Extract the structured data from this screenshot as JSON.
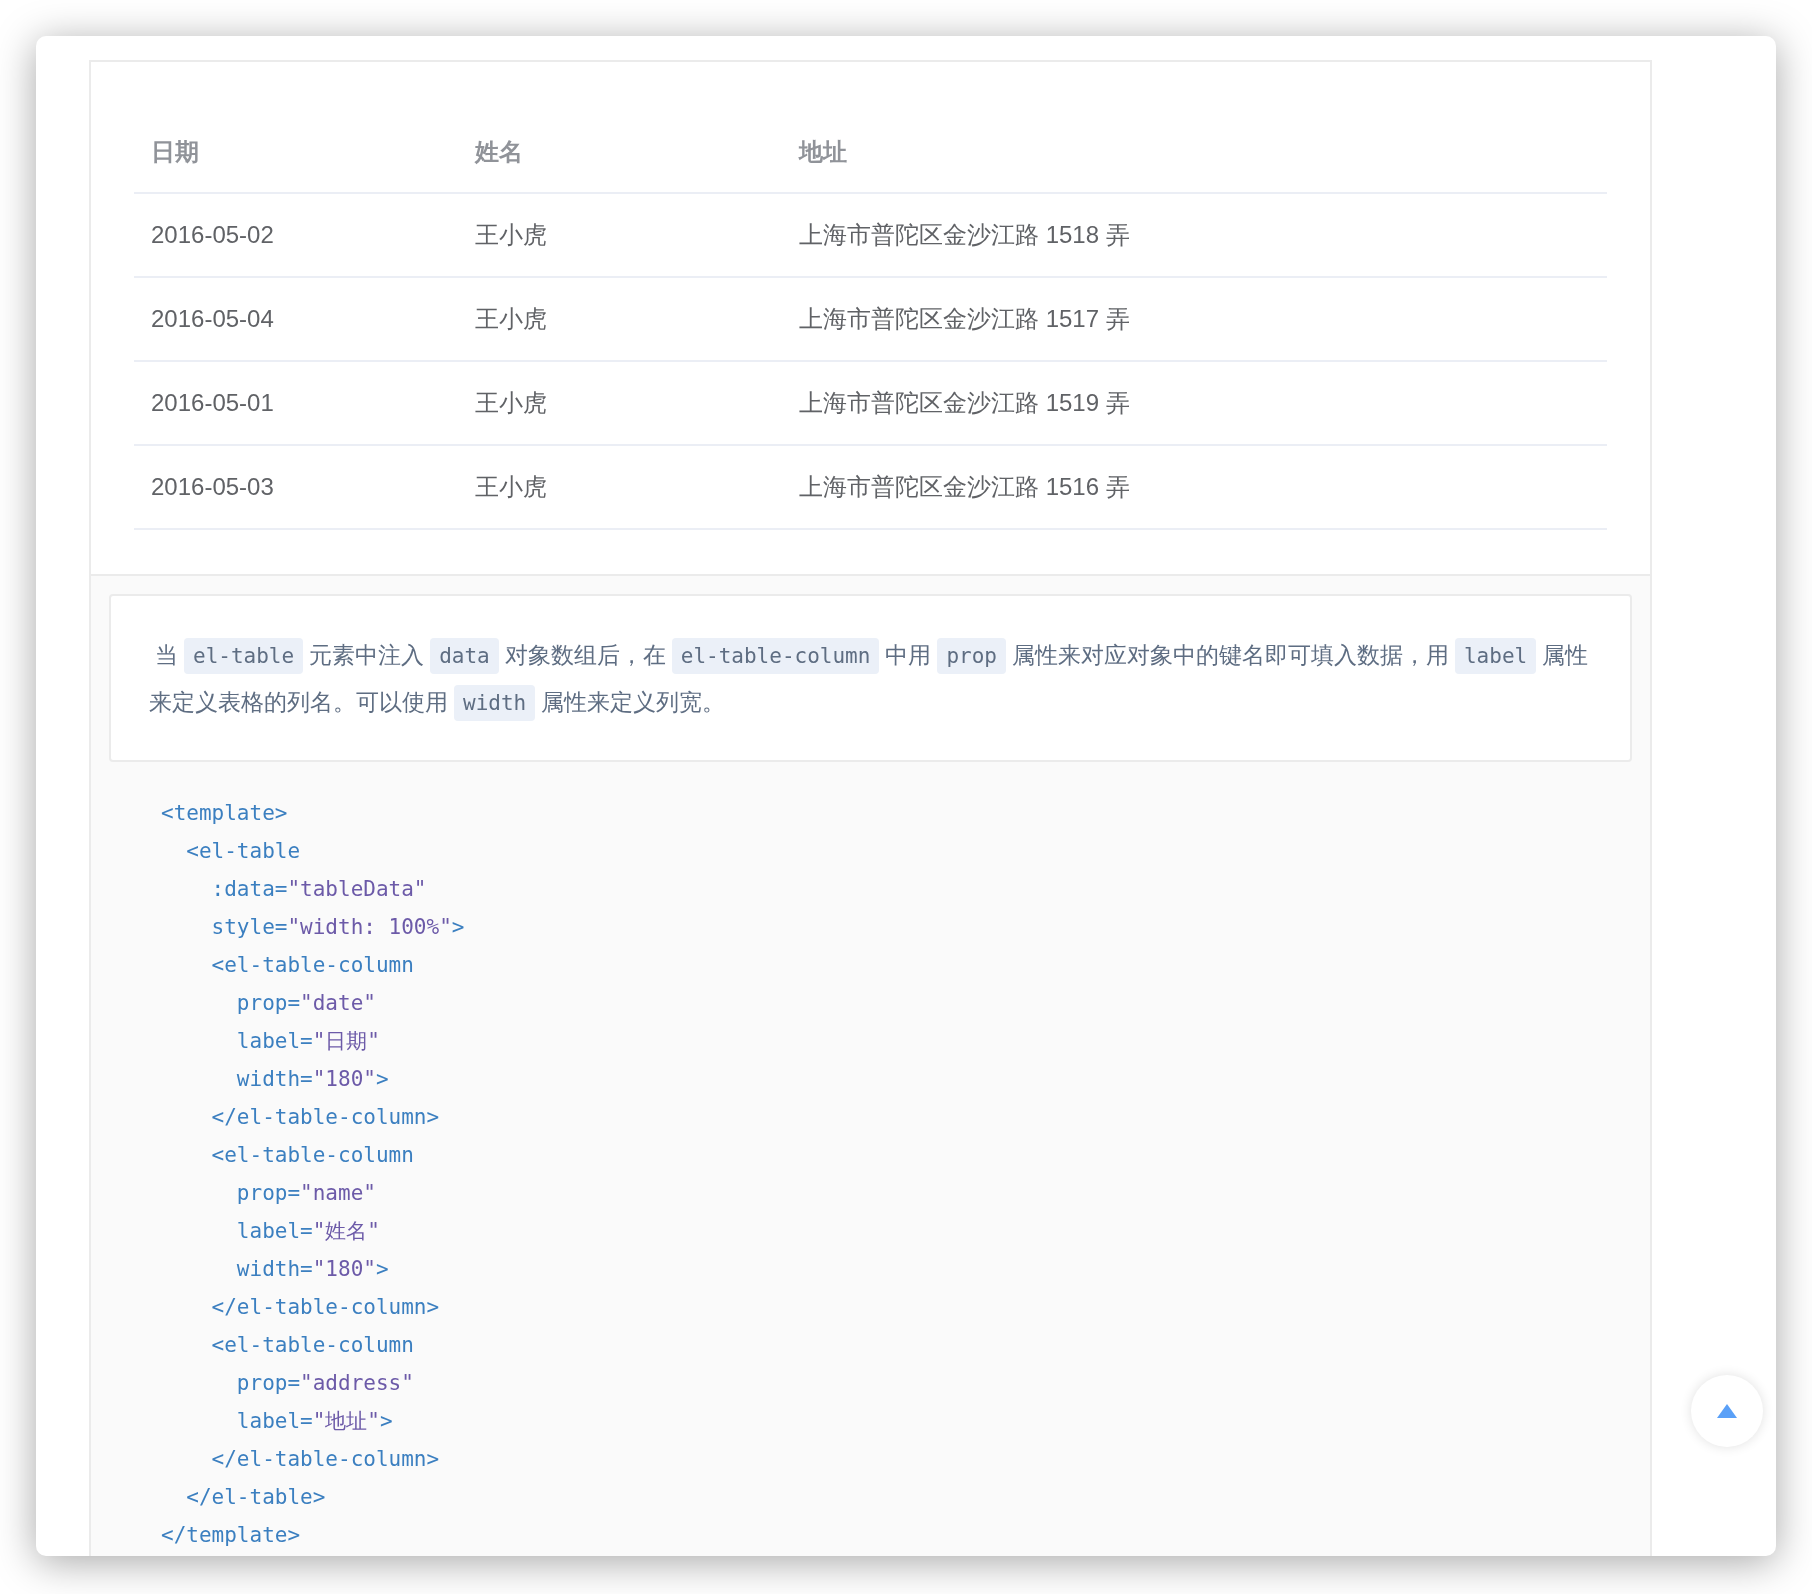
{
  "table": {
    "columns": [
      "日期",
      "姓名",
      "地址"
    ],
    "rows": [
      [
        "2016-05-02",
        "王小虎",
        "上海市普陀区金沙江路 1518 弄"
      ],
      [
        "2016-05-04",
        "王小虎",
        "上海市普陀区金沙江路 1517 弄"
      ],
      [
        "2016-05-01",
        "王小虎",
        "上海市普陀区金沙江路 1519 弄"
      ],
      [
        "2016-05-03",
        "王小虎",
        "上海市普陀区金沙江路 1516 弄"
      ]
    ]
  },
  "description": [
    {
      "kind": "text",
      "text": "当"
    },
    {
      "kind": "code",
      "text": "el-table"
    },
    {
      "kind": "text",
      "text": "元素中注入"
    },
    {
      "kind": "code",
      "text": "data"
    },
    {
      "kind": "text",
      "text": "对象数组后，在"
    },
    {
      "kind": "code",
      "text": "el-table-column"
    },
    {
      "kind": "text",
      "text": "中用"
    },
    {
      "kind": "code",
      "text": "prop"
    },
    {
      "kind": "text",
      "text": "属性来对应对象中的键名即可填入数据，用"
    },
    {
      "kind": "code",
      "text": "label"
    },
    {
      "kind": "text",
      "text": "属性来定义表格的列名。可以使用"
    },
    {
      "kind": "code",
      "text": "width"
    },
    {
      "kind": "text",
      "text": "属性来定义列宽。"
    }
  ],
  "code_lines": [
    [
      {
        "kind": "tag",
        "text": "<template>"
      }
    ],
    [
      {
        "kind": "tag",
        "text": "  <el-table"
      }
    ],
    [
      {
        "kind": "attr",
        "text": "    :data="
      },
      {
        "kind": "string",
        "text": "\"tableData\""
      }
    ],
    [
      {
        "kind": "attr",
        "text": "    style="
      },
      {
        "kind": "string",
        "text": "\"width: 100%\""
      },
      {
        "kind": "tag",
        "text": ">"
      }
    ],
    [
      {
        "kind": "tag",
        "text": "    <el-table-column"
      }
    ],
    [
      {
        "kind": "attr",
        "text": "      prop="
      },
      {
        "kind": "string",
        "text": "\"date\""
      }
    ],
    [
      {
        "kind": "attr",
        "text": "      label="
      },
      {
        "kind": "string",
        "text": "\"日期\""
      }
    ],
    [
      {
        "kind": "attr",
        "text": "      width="
      },
      {
        "kind": "string",
        "text": "\"180\""
      },
      {
        "kind": "tag",
        "text": ">"
      }
    ],
    [
      {
        "kind": "tag",
        "text": "    </el-table-column>"
      }
    ],
    [
      {
        "kind": "tag",
        "text": "    <el-table-column"
      }
    ],
    [
      {
        "kind": "attr",
        "text": "      prop="
      },
      {
        "kind": "string",
        "text": "\"name\""
      }
    ],
    [
      {
        "kind": "attr",
        "text": "      label="
      },
      {
        "kind": "string",
        "text": "\"姓名\""
      }
    ],
    [
      {
        "kind": "attr",
        "text": "      width="
      },
      {
        "kind": "string",
        "text": "\"180\""
      },
      {
        "kind": "tag",
        "text": ">"
      }
    ],
    [
      {
        "kind": "tag",
        "text": "    </el-table-column>"
      }
    ],
    [
      {
        "kind": "tag",
        "text": "    <el-table-column"
      }
    ],
    [
      {
        "kind": "attr",
        "text": "      prop="
      },
      {
        "kind": "string",
        "text": "\"address\""
      }
    ],
    [
      {
        "kind": "attr",
        "text": "      label="
      },
      {
        "kind": "string",
        "text": "\"地址\""
      },
      {
        "kind": "tag",
        "text": ">"
      }
    ],
    [
      {
        "kind": "tag",
        "text": "    </el-table-column>"
      }
    ],
    [
      {
        "kind": "tag",
        "text": "  </el-table>"
      }
    ],
    [
      {
        "kind": "tag",
        "text": "</template>"
      }
    ]
  ]
}
